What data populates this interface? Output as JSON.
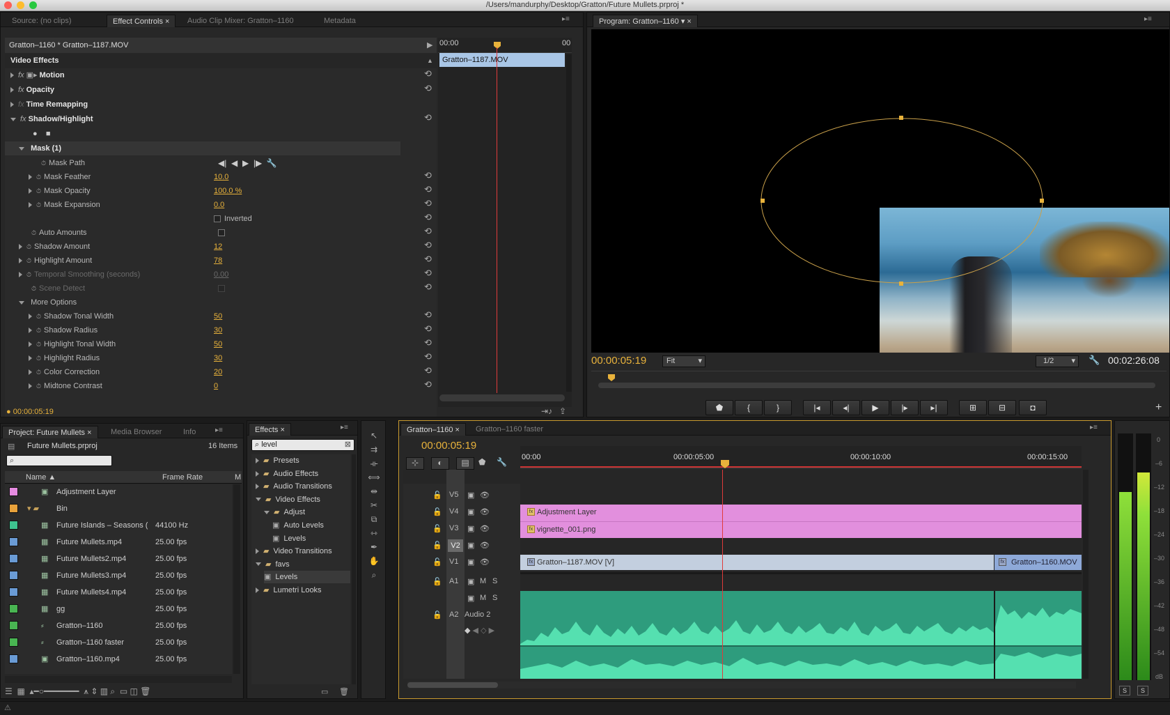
{
  "window": {
    "title": "/Users/mandurphy/Desktop/Gratton/Future Mullets.prproj *"
  },
  "source_tabs": {
    "source": "Source: (no clips)",
    "effect_controls": "Effect Controls",
    "audio_mixer": "Audio Clip Mixer: Gratton–1160",
    "metadata": "Metadata"
  },
  "effect_controls": {
    "clip_header": "Gratton–1160 * Gratton–1187.MOV",
    "timeline_start": "00:00",
    "timeline_end": "00",
    "clip_bar": "Gratton–1187.MOV",
    "section": "Video Effects",
    "effects": {
      "motion": "Motion",
      "opacity": "Opacity",
      "time_remapping": "Time Remapping",
      "shadow_highlight": "Shadow/Highlight"
    },
    "mask": "Mask (1)",
    "mask_path": "Mask Path",
    "mask_feather": {
      "label": "Mask Feather",
      "value": "10.0"
    },
    "mask_opacity": {
      "label": "Mask Opacity",
      "value": "100.0 %"
    },
    "mask_expansion": {
      "label": "Mask Expansion",
      "value": "0.0"
    },
    "inverted": "Inverted",
    "auto_amounts": "Auto Amounts",
    "shadow_amount": {
      "label": "Shadow Amount",
      "value": "12"
    },
    "highlight_amount": {
      "label": "Highlight Amount",
      "value": "78"
    },
    "temporal_smoothing": {
      "label": "Temporal Smoothing (seconds)",
      "value": "0.00"
    },
    "scene_detect": "Scene Detect",
    "more_options": "More Options",
    "shadow_tonal_width": {
      "label": "Shadow Tonal Width",
      "value": "50"
    },
    "shadow_radius": {
      "label": "Shadow Radius",
      "value": "30"
    },
    "highlight_tonal_width": {
      "label": "Highlight Tonal Width",
      "value": "50"
    },
    "highlight_radius": {
      "label": "Highlight Radius",
      "value": "30"
    },
    "color_correction": {
      "label": "Color Correction",
      "value": "20"
    },
    "midtone_contrast": {
      "label": "Midtone Contrast",
      "value": "0"
    },
    "timecode": "00:00:05:19"
  },
  "program": {
    "tab": "Program: Gratton–1160",
    "timecode": "00:00:05:19",
    "fit": "Fit",
    "resolution": "1/2",
    "duration": "00:02:26:08"
  },
  "project": {
    "tabs": {
      "project": "Project: Future Mullets",
      "media_browser": "Media Browser",
      "info": "Info"
    },
    "file": "Future Mullets.prproj",
    "count": "16 Items",
    "col_name": "Name",
    "col_rate": "Frame Rate",
    "col_m": "M",
    "items": [
      {
        "name": "Adjustment Layer",
        "rate": "",
        "color": "#e58be0"
      },
      {
        "name": "Bin",
        "rate": "",
        "color": "#e8a23b"
      },
      {
        "name": "Future Islands – Seasons (",
        "rate": "44100 Hz",
        "color": "#3ec28f"
      },
      {
        "name": "Future Mullets.mp4",
        "rate": "25.00 fps",
        "color": "#6a9bd5"
      },
      {
        "name": "Future Mullets2.mp4",
        "rate": "25.00 fps",
        "color": "#6a9bd5"
      },
      {
        "name": "Future Mullets3.mp4",
        "rate": "25.00 fps",
        "color": "#6a9bd5"
      },
      {
        "name": "Future Mullets4.mp4",
        "rate": "25.00 fps",
        "color": "#6a9bd5"
      },
      {
        "name": "gg",
        "rate": "25.00 fps",
        "color": "#49b552"
      },
      {
        "name": "Gratton–1160",
        "rate": "25.00 fps",
        "color": "#49b552"
      },
      {
        "name": "Gratton–1160 faster",
        "rate": "25.00 fps",
        "color": "#49b552"
      },
      {
        "name": "Gratton–1160.mp4",
        "rate": "25.00 fps",
        "color": "#6a9bd5"
      }
    ]
  },
  "effects_panel": {
    "tab": "Effects",
    "search": "level",
    "items": [
      "Presets",
      "Audio Effects",
      "Audio Transitions",
      "Video Effects",
      "Adjust",
      "Auto Levels",
      "Levels",
      "Video Transitions",
      "favs",
      "Levels",
      "Lumetri Looks"
    ]
  },
  "timeline": {
    "tabs": {
      "main": "Gratton–1160",
      "faster": "Gratton–1160 faster"
    },
    "timecode": "00:00:05:19",
    "ruler": [
      "00:00",
      "00:00:05:00",
      "00:00:10:00",
      "00:00:15:00"
    ],
    "tracks": [
      "V5",
      "V4",
      "V3",
      "V2",
      "V1",
      "A1",
      "A2"
    ],
    "audio2_label": "Audio 2",
    "clips": {
      "adjustment": "Adjustment Layer",
      "vignette": "vignette_001.png",
      "v1a": "Gratton–1187.MOV [V]",
      "v1b": "Gratton–1160.MOV"
    },
    "m": "M",
    "s": "S"
  },
  "meter": {
    "scale": [
      "0",
      "–6",
      "–12",
      "–18",
      "–24",
      "–30",
      "–36",
      "–42",
      "–48",
      "–54",
      "dB"
    ],
    "s_left": "S",
    "s_right": "S"
  }
}
